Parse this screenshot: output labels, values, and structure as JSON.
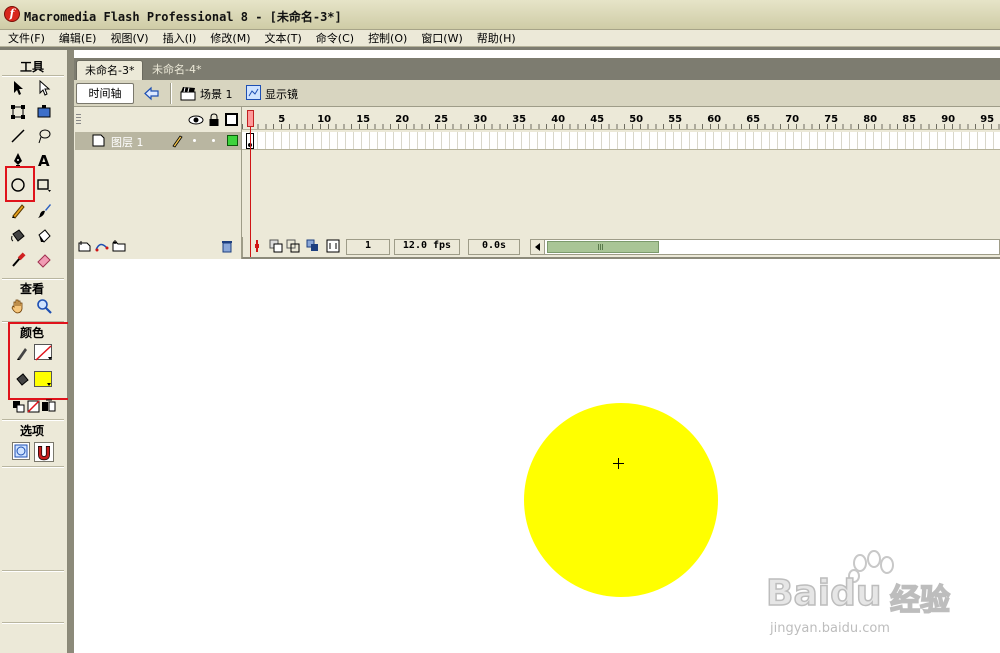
{
  "window": {
    "title": "Macromedia Flash Professional 8 - [未命名-3*]"
  },
  "menu": [
    "文件(F)",
    "编辑(E)",
    "视图(V)",
    "插入(I)",
    "修改(M)",
    "文本(T)",
    "命令(C)",
    "控制(O)",
    "窗口(W)",
    "帮助(H)"
  ],
  "tools": {
    "title": "工具",
    "view_title": "查看",
    "colors_title": "颜色",
    "options_title": "选项",
    "stroke_color": "none",
    "fill_color": "#ffff00",
    "selected_tool": "oval-tool"
  },
  "tabs": [
    {
      "label": "未命名-3*",
      "active": true
    },
    {
      "label": "未命名-4*",
      "active": false
    }
  ],
  "editbar": {
    "timeline_button": "时间轴",
    "scene": "场景 1",
    "stage_view": "显示镜"
  },
  "timeline": {
    "layer_name": "图层 1",
    "ruler_labels": [
      "1",
      "5",
      "10",
      "15",
      "20",
      "25",
      "30",
      "35",
      "40",
      "45",
      "50",
      "55",
      "60",
      "65",
      "70",
      "75",
      "80",
      "85",
      "90",
      "95"
    ],
    "current_frame": "1",
    "frame_rate": "12.0 fps",
    "elapsed_time": "0.0s"
  },
  "stage": {
    "shape": "circle",
    "fill_color": "#ffff00"
  },
  "watermark": {
    "brand": "Baidu",
    "product": "经验",
    "url": "jingyan.baidu.com"
  }
}
